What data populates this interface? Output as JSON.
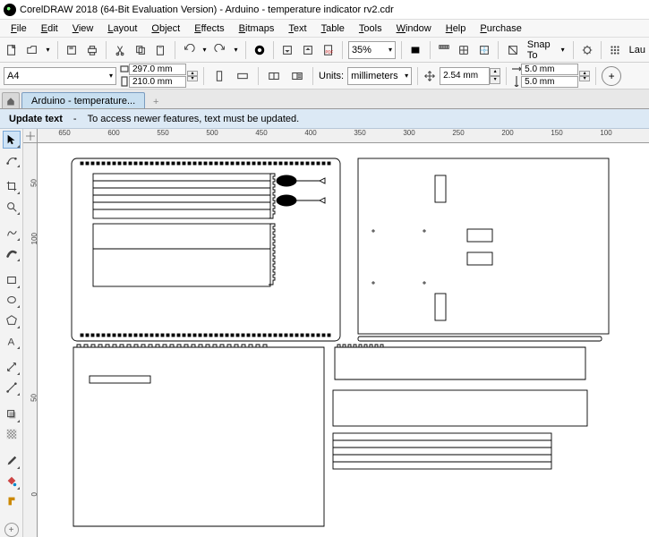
{
  "title": "CorelDRAW 2018 (64-Bit Evaluation Version) - Arduino - temperature indicator rv2.cdr",
  "menu": [
    "File",
    "Edit",
    "View",
    "Layout",
    "Object",
    "Effects",
    "Bitmaps",
    "Text",
    "Table",
    "Tools",
    "Window",
    "Help",
    "Purchase"
  ],
  "toolbar": {
    "zoom_value": "35%",
    "snap_label": "Snap To"
  },
  "propbar": {
    "page_size": "A4",
    "page_w": "297.0 mm",
    "page_h": "210.0 mm",
    "units_label": "Units:",
    "units_value": "millimeters",
    "nudge": "2.54 mm",
    "dup_x": "5.0 mm",
    "dup_y": "5.0 mm",
    "lau": "Lau"
  },
  "tab": {
    "label": "Arduino - temperature..."
  },
  "infobar": {
    "title": "Update text",
    "sep": "-",
    "msg": "To access newer features, text must be updated."
  },
  "ruler_h": [
    "650",
    "600",
    "550",
    "500",
    "450",
    "400",
    "350",
    "300",
    "250",
    "200",
    "150",
    "100"
  ],
  "ruler_v": [
    "50",
    "100",
    "50",
    "0"
  ]
}
